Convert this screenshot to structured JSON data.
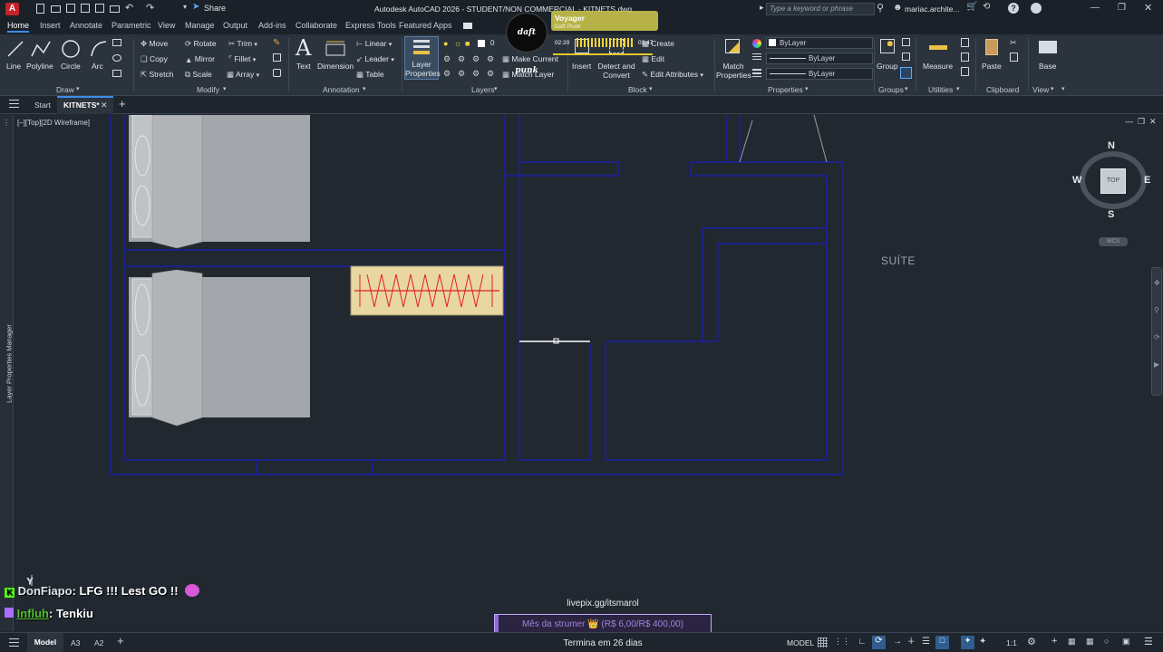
{
  "titlebar": {
    "app_letter": "A",
    "share_label": "Share",
    "title": "Autodesk AutoCAD 2026 - STUDENT/NON COMMERCIAL - KITNETS.dwg",
    "search_placeholder": "Type a keyword or phrase",
    "user": "mariac.archite..."
  },
  "media": {
    "song": "Voyager",
    "artist": "Daft Punk",
    "elapsed": "02:20",
    "total": "03:47",
    "logo_text": "daft punk"
  },
  "ribbon_tabs": [
    "Home",
    "Insert",
    "Annotate",
    "Parametric",
    "View",
    "Manage",
    "Output",
    "Add-ins",
    "Collaborate",
    "Express Tools",
    "Featured Apps"
  ],
  "draw": {
    "line": "Line",
    "polyline": "Polyline",
    "circle": "Circle",
    "arc": "Arc",
    "panel": "Draw"
  },
  "modify": {
    "move": "Move",
    "rotate": "Rotate",
    "trim": "Trim",
    "copy": "Copy",
    "mirror": "Mirror",
    "fillet": "Fillet",
    "stretch": "Stretch",
    "scale": "Scale",
    "array": "Array",
    "panel": "Modify"
  },
  "annotation": {
    "text": "Text",
    "dimension": "Dimension",
    "linear": "Linear",
    "leader": "Leader",
    "table": "Table",
    "panel": "Annotation"
  },
  "layers": {
    "layer_properties": "Layer Properties",
    "make_current": "Make Current",
    "match_layer": "Match Layer",
    "panel": "Layers",
    "current_layer": "0"
  },
  "block": {
    "insert": "Insert",
    "create": "Create",
    "edit": "Edit",
    "detect_convert": "Detect and Convert",
    "edit_attributes": "Edit Attributes",
    "panel": "Block"
  },
  "properties": {
    "match": "Match Properties",
    "color": "ByLayer",
    "linetype": "ByLayer",
    "lineweight": "ByLayer",
    "panel": "Properties"
  },
  "groups": {
    "group": "Group",
    "panel": "Groups"
  },
  "utilities": {
    "measure": "Measure",
    "panel": "Utilities"
  },
  "clipboard": {
    "paste": "Paste",
    "panel": "Clipboard"
  },
  "view": {
    "base": "Base",
    "panel": "View"
  },
  "filetabs": {
    "start": "Start",
    "current": "KITNETS*"
  },
  "viewport": {
    "label": "[–][Top][2D Wireframe]"
  },
  "drawing": {
    "room_label": "SUÍTE"
  },
  "viewcube": {
    "north": "N",
    "south": "S",
    "east": "E",
    "west": "W",
    "face": "TOP",
    "wcs": "WCS"
  },
  "left_palette": {
    "label": "Layer Properties Manager"
  },
  "chat": [
    {
      "user": "DonFiapo",
      "message": ": LFG !!! Lest GO !!"
    },
    {
      "user": "Influh",
      "message": ": Tenkiu"
    }
  ],
  "overlay": {
    "url": "livepix.gg/itsmarol",
    "goal": "Mês da strumer 👑 (R$ 6,00/R$ 400,00)",
    "goal_progress": 0.015,
    "ends": "Termina em 26 dias"
  },
  "statusbar": {
    "layouts": [
      "Model",
      "A3",
      "A2"
    ],
    "mode": "MODEL",
    "scale": "1:1"
  },
  "colors": {
    "wall_blue": "#1b1fa8",
    "furniture_gray": "#a3a7ab",
    "accent": "#3b8ee8"
  }
}
